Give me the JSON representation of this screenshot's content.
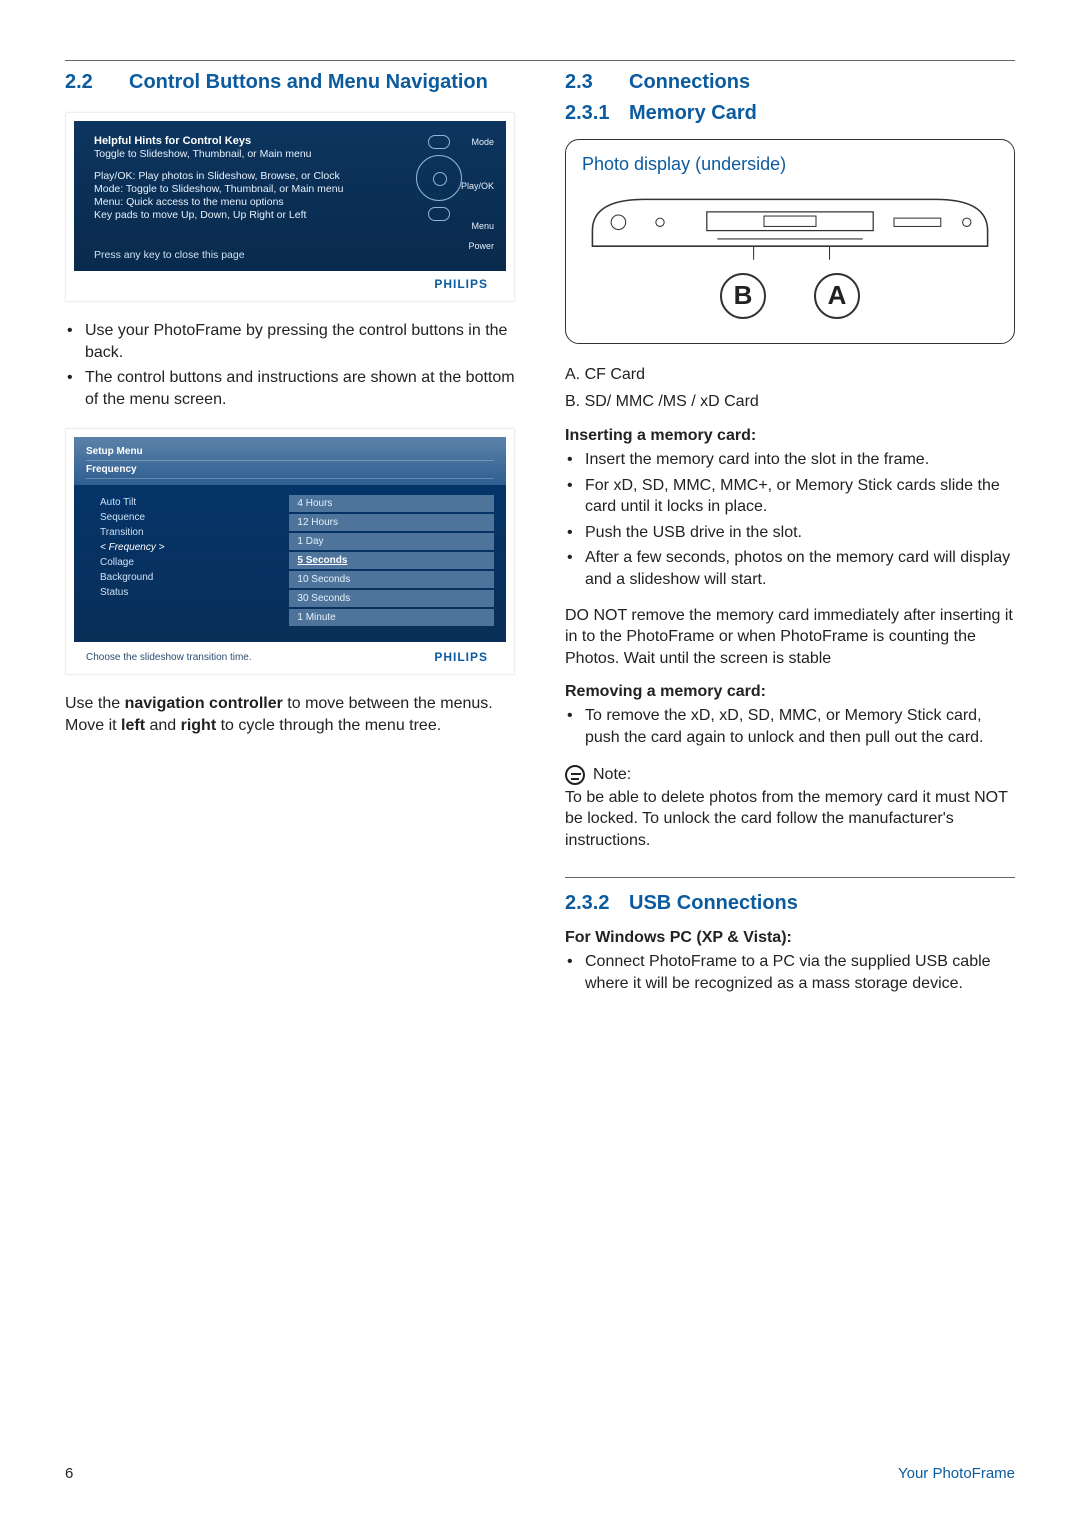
{
  "left": {
    "section_num": "2.2",
    "section_title": "Control Buttons and Menu Navigation",
    "fig1": {
      "title": "Helpful Hints for Control Keys",
      "l1": "Toggle to Slideshow, Thumbnail, or Main menu",
      "l2": "Play/OK: Play photos in Slideshow, Browse, or Clock",
      "l3": "Mode: Toggle to Slideshow, Thumbnail, or Main menu",
      "l4": "Menu: Quick access to the menu options",
      "l5": "Key pads to move Up, Down, Up Right or Left",
      "footer": "Press any key to close this page",
      "r_mode": "Mode",
      "r_play": "Play/OK",
      "r_menu": "Menu",
      "r_power": "Power",
      "brand": "PHILIPS"
    },
    "b1_li1": "Use your PhotoFrame by pressing the control buttons in the back.",
    "b1_li2": "The control buttons and instructions are shown at the bottom of the menu screen.",
    "fig2": {
      "top1": "Setup Menu",
      "top2": "Frequency",
      "left_items": [
        "Auto Tilt",
        "Sequence",
        "Transition",
        "< Frequency >",
        "Collage",
        "Background",
        "Status"
      ],
      "left_sel_index": 3,
      "right_items": [
        "4 Hours",
        "12 Hours",
        "1 Day",
        "5 Seconds",
        "10 Seconds",
        "30 Seconds",
        "1 Minute"
      ],
      "right_sel_index": 3,
      "caption": "Choose the slideshow transition time.",
      "brand": "PHILIPS"
    },
    "nav_p_1": "Use the ",
    "nav_p_b1": "navigation controller",
    "nav_p_2": " to move between the menus. Move it ",
    "nav_p_b2": "left",
    "nav_p_3": " and ",
    "nav_p_b3": "right",
    "nav_p_4": " to cycle through the menu tree."
  },
  "right": {
    "section_num": "2.3",
    "section_title": "Connections",
    "sub1_num": "2.3.1",
    "sub1_title": "Memory Card",
    "fig3_label": "Photo display (underside)",
    "fig3_slot_b": "B",
    "fig3_slot_a": "A",
    "slot_a_text": "A. CF Card",
    "slot_b_text": "B. SD/ MMC /MS / xD Card",
    "insert_hdr": "Inserting a memory card:",
    "insert_li1": "Insert the memory card into the slot in the frame.",
    "insert_li2": "For xD, SD, MMC, MMC+, or Memory Stick cards slide the card until it locks in place.",
    "insert_li3": "Push the USB drive in the slot.",
    "insert_li4": "After a few seconds, photos on the memory card will display and a slideshow will start.",
    "warn_para": "DO NOT remove the memory card immediately after inserting it in to the PhotoFrame or when PhotoFrame is counting the Photos. Wait until the screen is stable",
    "remove_hdr": "Removing a memory card:",
    "remove_li1": "To remove the xD, xD, SD, MMC, or Memory Stick card, push the card again to unlock and then pull out the card.",
    "note_label": "Note:",
    "note_para": "To be able to delete photos from the memory card it must NOT be locked. To unlock the card follow the manufacturer's instructions.",
    "sub2_num": "2.3.2",
    "sub2_title": "USB Connections",
    "usb_hdr": "For Windows PC (XP & Vista):",
    "usb_li1": "Connect PhotoFrame to a PC via the supplied USB cable where it will be recognized as a mass storage device."
  },
  "footer": {
    "page_num": "6",
    "section_name": "Your PhotoFrame"
  }
}
